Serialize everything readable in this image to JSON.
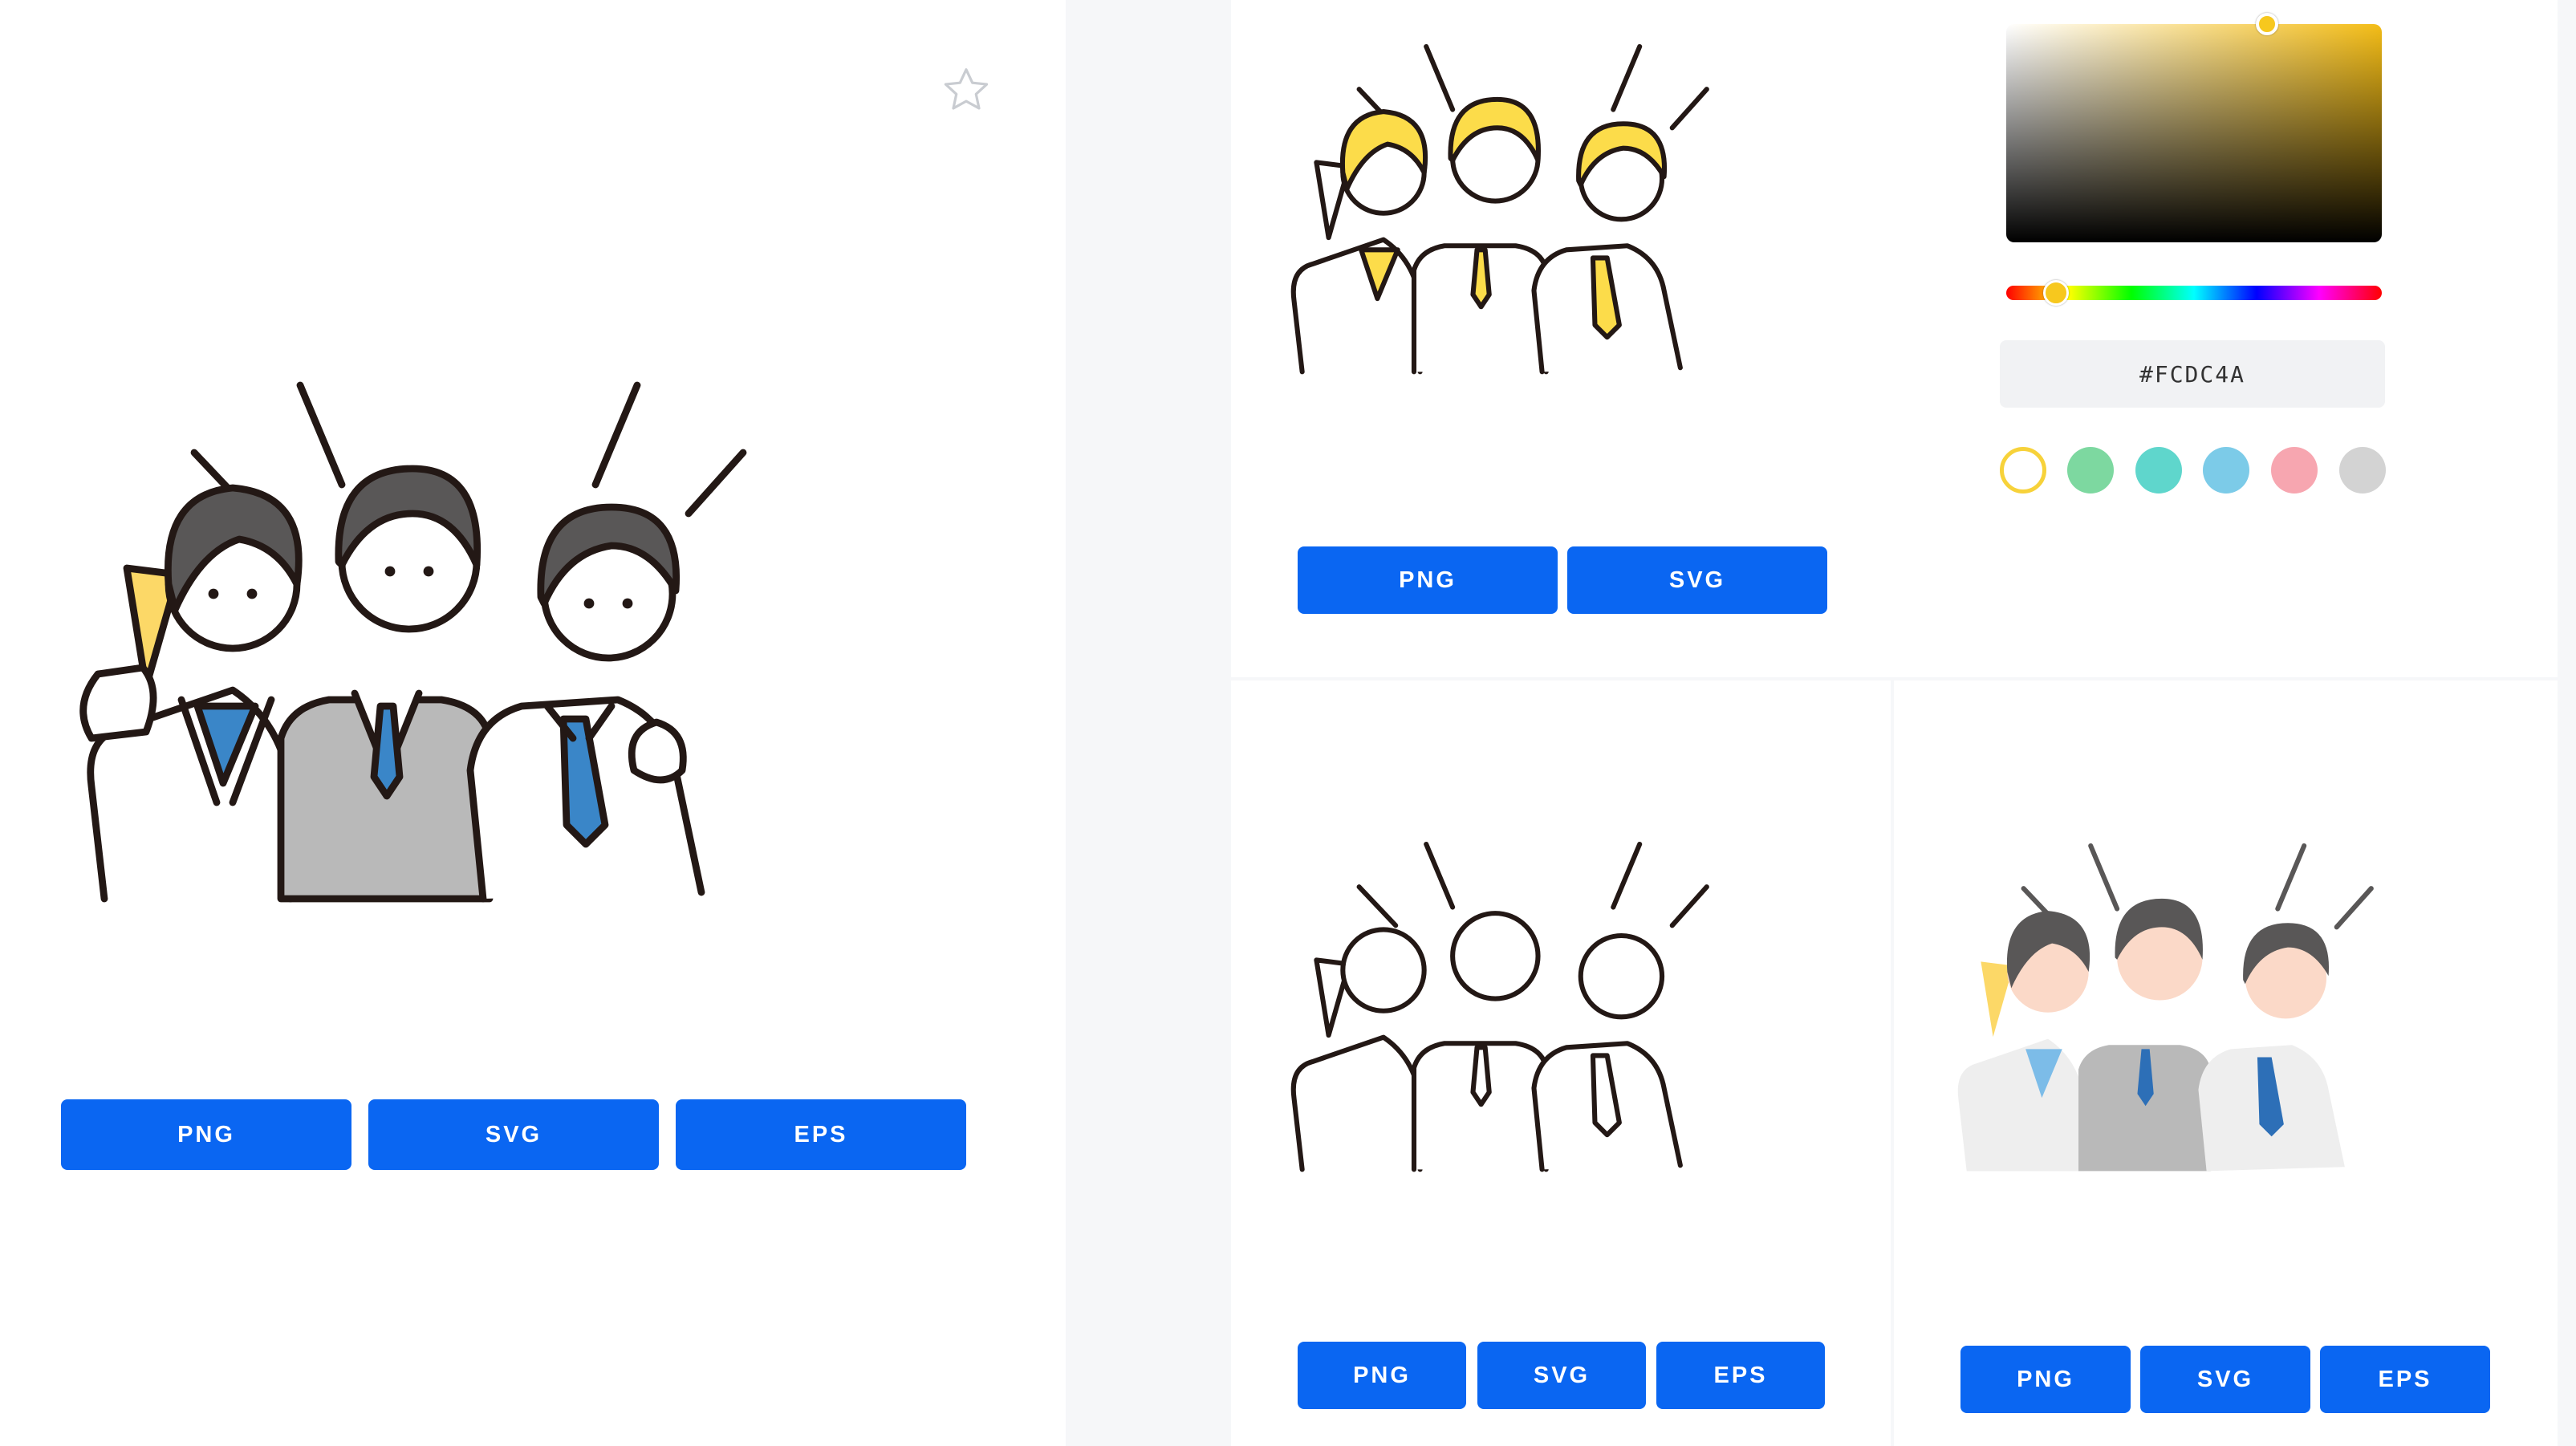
{
  "main": {
    "downloads": [
      "PNG",
      "SVG",
      "EPS"
    ]
  },
  "colorize": {
    "downloads": [
      "PNG",
      "SVG"
    ],
    "hex_value": "#FCDC4A",
    "swatches": [
      {
        "color": "#ffffff",
        "border": "#f7d23a",
        "selected": true
      },
      {
        "color": "#7dd8a0"
      },
      {
        "color": "#5fd6cc"
      },
      {
        "color": "#7ccbe8"
      },
      {
        "color": "#f7a6b0"
      },
      {
        "color": "#d3d3d3"
      }
    ],
    "accent": "#FCDC4A"
  },
  "outline": {
    "downloads": [
      "PNG",
      "SVG",
      "EPS"
    ]
  },
  "nostroke": {
    "downloads": [
      "PNG",
      "SVG",
      "EPS"
    ]
  },
  "theme": {
    "button_blue": "#0a66f2",
    "icons": [
      "star-icon"
    ]
  }
}
